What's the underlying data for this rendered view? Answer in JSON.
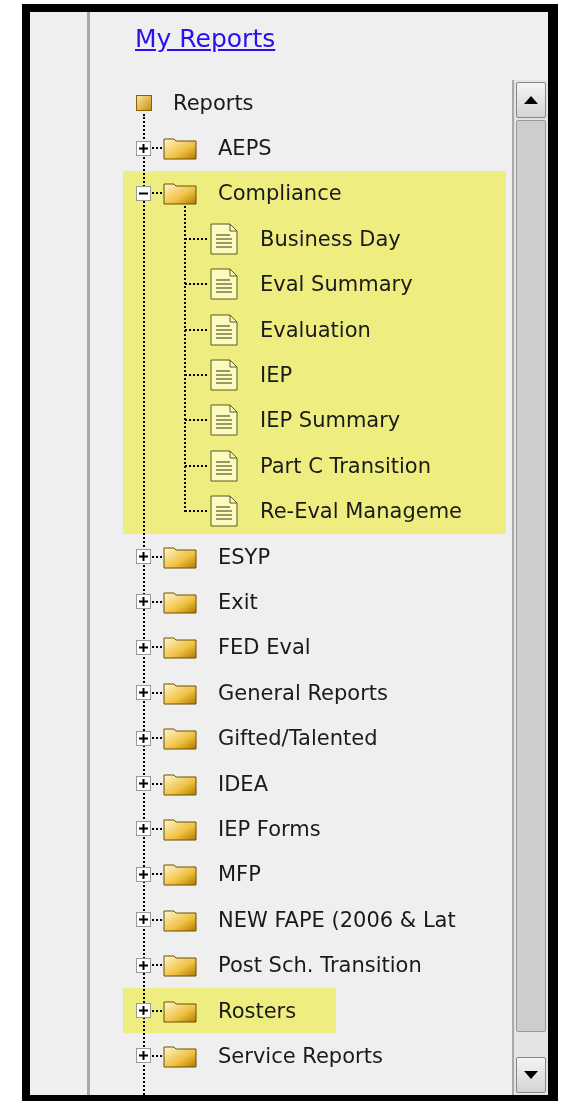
{
  "link": {
    "text": "My Reports"
  },
  "tree": {
    "root": {
      "label": "Reports"
    },
    "items": [
      {
        "label": "AEPS",
        "expanded": false,
        "highlighted": false
      },
      {
        "label": "Compliance",
        "expanded": true,
        "highlighted": true,
        "children": [
          {
            "label": "Business Day"
          },
          {
            "label": "Eval Summary"
          },
          {
            "label": "Evaluation"
          },
          {
            "label": "IEP"
          },
          {
            "label": "IEP Summary"
          },
          {
            "label": "Part C Transition"
          },
          {
            "label": "Re-Eval Manageme"
          }
        ]
      },
      {
        "label": "ESYP",
        "expanded": false,
        "highlighted": false
      },
      {
        "label": "Exit",
        "expanded": false,
        "highlighted": false
      },
      {
        "label": "FED Eval",
        "expanded": false,
        "highlighted": false
      },
      {
        "label": "General Reports",
        "expanded": false,
        "highlighted": false
      },
      {
        "label": "Gifted/Talented",
        "expanded": false,
        "highlighted": false
      },
      {
        "label": "IDEA",
        "expanded": false,
        "highlighted": false
      },
      {
        "label": "IEP Forms",
        "expanded": false,
        "highlighted": false
      },
      {
        "label": "MFP",
        "expanded": false,
        "highlighted": false
      },
      {
        "label": "NEW FAPE (2006 & Lat",
        "expanded": false,
        "highlighted": false
      },
      {
        "label": "Post Sch. Transition",
        "expanded": false,
        "highlighted": false
      },
      {
        "label": "Rosters",
        "expanded": false,
        "highlighted": true
      },
      {
        "label": "Service Reports",
        "expanded": false,
        "highlighted": false
      }
    ]
  }
}
